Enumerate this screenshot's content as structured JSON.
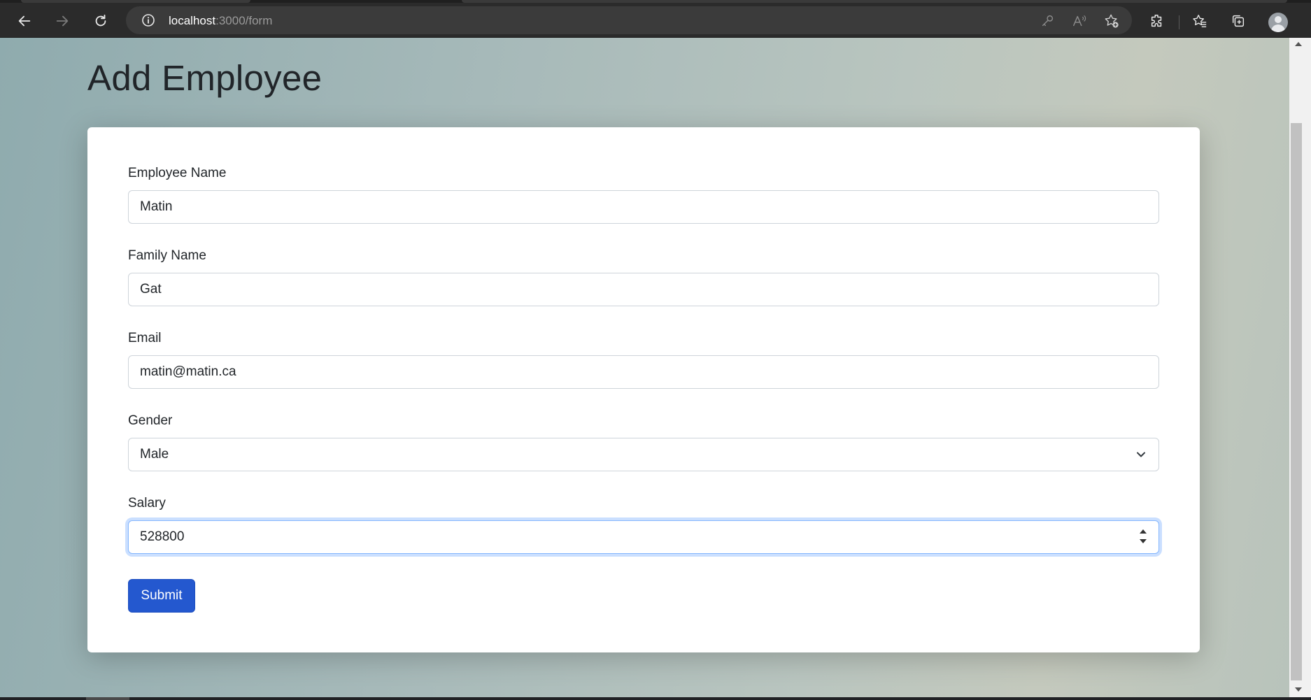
{
  "browser": {
    "url_host": "localhost",
    "url_path": ":3000/form",
    "icons": [
      "back-arrow-icon",
      "forward-arrow-icon",
      "reload-icon",
      "site-info-icon",
      "key-icon",
      "read-aloud-icon",
      "add-favorite-icon",
      "extensions-icon",
      "favorites-icon",
      "collections-icon",
      "profile-avatar"
    ]
  },
  "page": {
    "title": "Add Employee"
  },
  "form": {
    "employee_name": {
      "label": "Employee Name",
      "value": "Matin"
    },
    "family_name": {
      "label": "Family Name",
      "value": "Gat"
    },
    "email": {
      "label": "Email",
      "value": "matin@matin.ca"
    },
    "gender": {
      "label": "Gender",
      "value": "Male"
    },
    "salary": {
      "label": "Salary",
      "value": "528800"
    },
    "submit_label": "Submit"
  },
  "colors": {
    "primary_button": "#2458cf",
    "focus_ring": "#86b7fe"
  }
}
